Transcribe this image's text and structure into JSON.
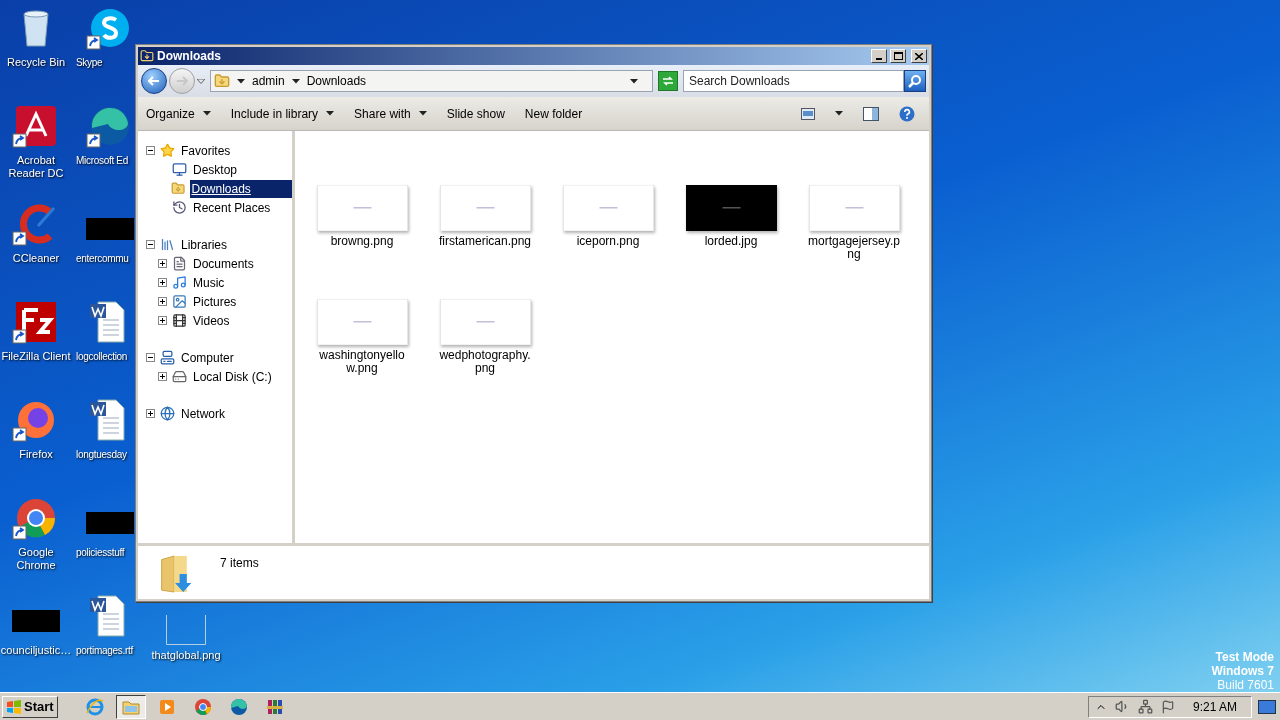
{
  "desktop": {
    "columns": [
      [
        {
          "label": "Recycle Bin",
          "kind": "recycle",
          "shortcut": false
        },
        {
          "label": "Acrobat Reader DC",
          "kind": "acrobat",
          "shortcut": true
        },
        {
          "label": "CCleaner",
          "kind": "ccleaner",
          "shortcut": true
        },
        {
          "label": "FileZilla Client",
          "kind": "filezilla",
          "shortcut": true
        },
        {
          "label": "Firefox",
          "kind": "firefox",
          "shortcut": true
        },
        {
          "label": "Google Chrome",
          "kind": "chrome",
          "shortcut": true
        },
        {
          "label": "counciljustic…",
          "kind": "dark_thumb",
          "shortcut": false
        }
      ],
      [
        {
          "label": "Skype",
          "kind": "skype",
          "shortcut": true
        },
        {
          "label": "Microsoft Ed",
          "kind": "edge",
          "shortcut": true
        },
        {
          "label": "entercommu",
          "kind": "dark_thumb",
          "shortcut": false
        },
        {
          "label": "logcollection",
          "kind": "word",
          "shortcut": false
        },
        {
          "label": "longtuesday",
          "kind": "word",
          "shortcut": false
        },
        {
          "label": "policiesstuff",
          "kind": "dark_thumb",
          "shortcut": false
        },
        {
          "label": "portimages.rtf",
          "kind": "word",
          "shortcut": false
        }
      ],
      [
        {
          "label": "thatglobal.png",
          "kind": "light_thumb"
        }
      ]
    ],
    "os_notice": [
      {
        "text": "Test Mode",
        "bold": true
      },
      {
        "text": "Windows 7",
        "bold": true
      },
      {
        "text": "Build 7601",
        "bold": false
      }
    ]
  },
  "window": {
    "title": "Downloads",
    "back": {
      "enabled": true
    },
    "forward": {
      "enabled": false
    },
    "breadcrumb": [
      "admin",
      "Downloads"
    ],
    "search": {
      "placeholder": "Search Downloads"
    },
    "toolbar": [
      {
        "label": "Organize",
        "menu": true
      },
      {
        "label": "Include in library",
        "menu": true
      },
      {
        "label": "Share with",
        "menu": true
      },
      {
        "label": "Slide show",
        "menu": false
      },
      {
        "label": "New folder",
        "menu": false
      }
    ],
    "tree": [
      {
        "label": "Favorites",
        "kind": "star",
        "expanded": true,
        "selected": false,
        "children": [
          {
            "label": "Desktop",
            "kind": "desktop",
            "selected": false
          },
          {
            "label": "Downloads",
            "kind": "downloads",
            "selected": true
          },
          {
            "label": "Recent Places",
            "kind": "recent",
            "selected": false
          }
        ]
      },
      {
        "label": "Libraries",
        "kind": "libraries",
        "expanded": true,
        "selected": false,
        "children": [
          {
            "label": "Documents",
            "kind": "documents",
            "expanded": false,
            "selected": false
          },
          {
            "label": "Music",
            "kind": "music",
            "expanded": false,
            "selected": false
          },
          {
            "label": "Pictures",
            "kind": "pictures",
            "expanded": false,
            "selected": false
          },
          {
            "label": "Videos",
            "kind": "videos",
            "expanded": false,
            "selected": false
          }
        ]
      },
      {
        "label": "Computer",
        "kind": "computer",
        "expanded": true,
        "selected": false,
        "children": [
          {
            "label": "Local Disk (C:)",
            "kind": "disk",
            "expanded": false,
            "selected": false
          }
        ]
      },
      {
        "label": "Network",
        "kind": "network",
        "expanded": false,
        "selected": false
      }
    ],
    "files": [
      {
        "name": "browng.png",
        "kind": "light"
      },
      {
        "name": "firstamerican.png",
        "kind": "light"
      },
      {
        "name": "iceporn.png",
        "kind": "light"
      },
      {
        "name": "lorded.jpg",
        "kind": "dark"
      },
      {
        "name": "mortgagejersey.png",
        "kind": "light"
      },
      {
        "name": "washingtonyellow.png",
        "kind": "light"
      },
      {
        "name": "wedphotography.png",
        "kind": "light"
      }
    ],
    "status": "7 items"
  },
  "taskbar": {
    "start": "Start",
    "apps": [
      {
        "kind": "ie",
        "active": false
      },
      {
        "kind": "explorer",
        "active": true
      },
      {
        "kind": "media",
        "active": false
      },
      {
        "kind": "chrome",
        "active": false
      },
      {
        "kind": "edge",
        "active": false
      },
      {
        "kind": "archive",
        "active": false
      }
    ],
    "clock": "9:21 AM"
  }
}
